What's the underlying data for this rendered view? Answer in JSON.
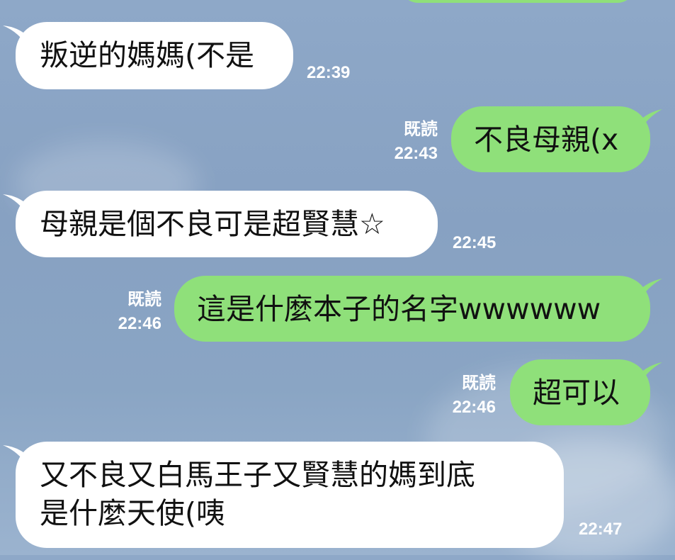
{
  "messages": [
    {
      "side": "in",
      "text": "叛逆的媽媽(不是",
      "time": "22:39"
    },
    {
      "side": "out",
      "text": "不良母親(x",
      "read": "既読",
      "time": "22:43"
    },
    {
      "side": "in",
      "text": "母親是個不良可是超賢慧☆",
      "time": "22:45"
    },
    {
      "side": "out",
      "text": "這是什麼本子的名字wwwwww",
      "read": "既読",
      "time": "22:46"
    },
    {
      "side": "out",
      "text": "超可以",
      "read": "既読",
      "time": "22:46"
    },
    {
      "side": "in",
      "text_line1": "又不良又白馬王子又賢慧的媽到底",
      "text_line2": "是什麼天使(咦",
      "time": "22:47"
    }
  ],
  "colors": {
    "outgoing": "#8fe07a",
    "incoming": "#ffffff",
    "background": "#8ea8c8"
  }
}
